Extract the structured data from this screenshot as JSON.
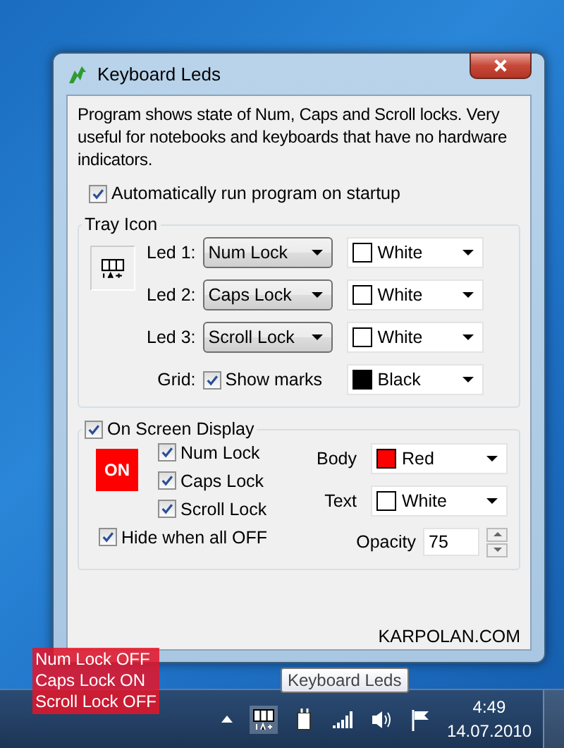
{
  "window": {
    "title": "Keyboard Leds"
  },
  "description": "Program shows state of Num, Caps and Scroll locks. Very useful for notebooks and keyboards that have no hardware indicators.",
  "autorun": {
    "label": "Automatically run program on startup",
    "checked": true
  },
  "tray_icon": {
    "title": "Tray Icon",
    "leds": [
      {
        "label": "Led 1:",
        "lock": "Num Lock",
        "color_name": "White",
        "color": "#ffffff"
      },
      {
        "label": "Led 2:",
        "lock": "Caps Lock",
        "color_name": "White",
        "color": "#ffffff"
      },
      {
        "label": "Led 3:",
        "lock": "Scroll Lock",
        "color_name": "White",
        "color": "#ffffff"
      }
    ],
    "grid": {
      "label": "Grid:",
      "checkbox_label": "Show marks",
      "checked": true,
      "color_name": "Black",
      "color": "#000000"
    }
  },
  "osd": {
    "label": "On Screen Display",
    "checked": true,
    "preview": "ON",
    "locks": [
      {
        "label": "Num Lock",
        "checked": true
      },
      {
        "label": "Caps Lock",
        "checked": true
      },
      {
        "label": "Scroll Lock",
        "checked": true
      }
    ],
    "hide_all_off": {
      "label": "Hide when all OFF",
      "checked": true
    },
    "body": {
      "label": "Body",
      "color_name": "Red",
      "color": "#ff0000"
    },
    "text": {
      "label": "Text",
      "color_name": "White",
      "color": "#ffffff"
    },
    "opacity": {
      "label": "Opacity",
      "value": "75"
    }
  },
  "footer": "KARPOLAN.COM",
  "osd_overlay": [
    "Num Lock OFF",
    "Caps Lock ON",
    "Scroll Lock OFF"
  ],
  "tooltip": "Keyboard Leds",
  "taskbar": {
    "time": "4:49",
    "date": "14.07.2010"
  }
}
